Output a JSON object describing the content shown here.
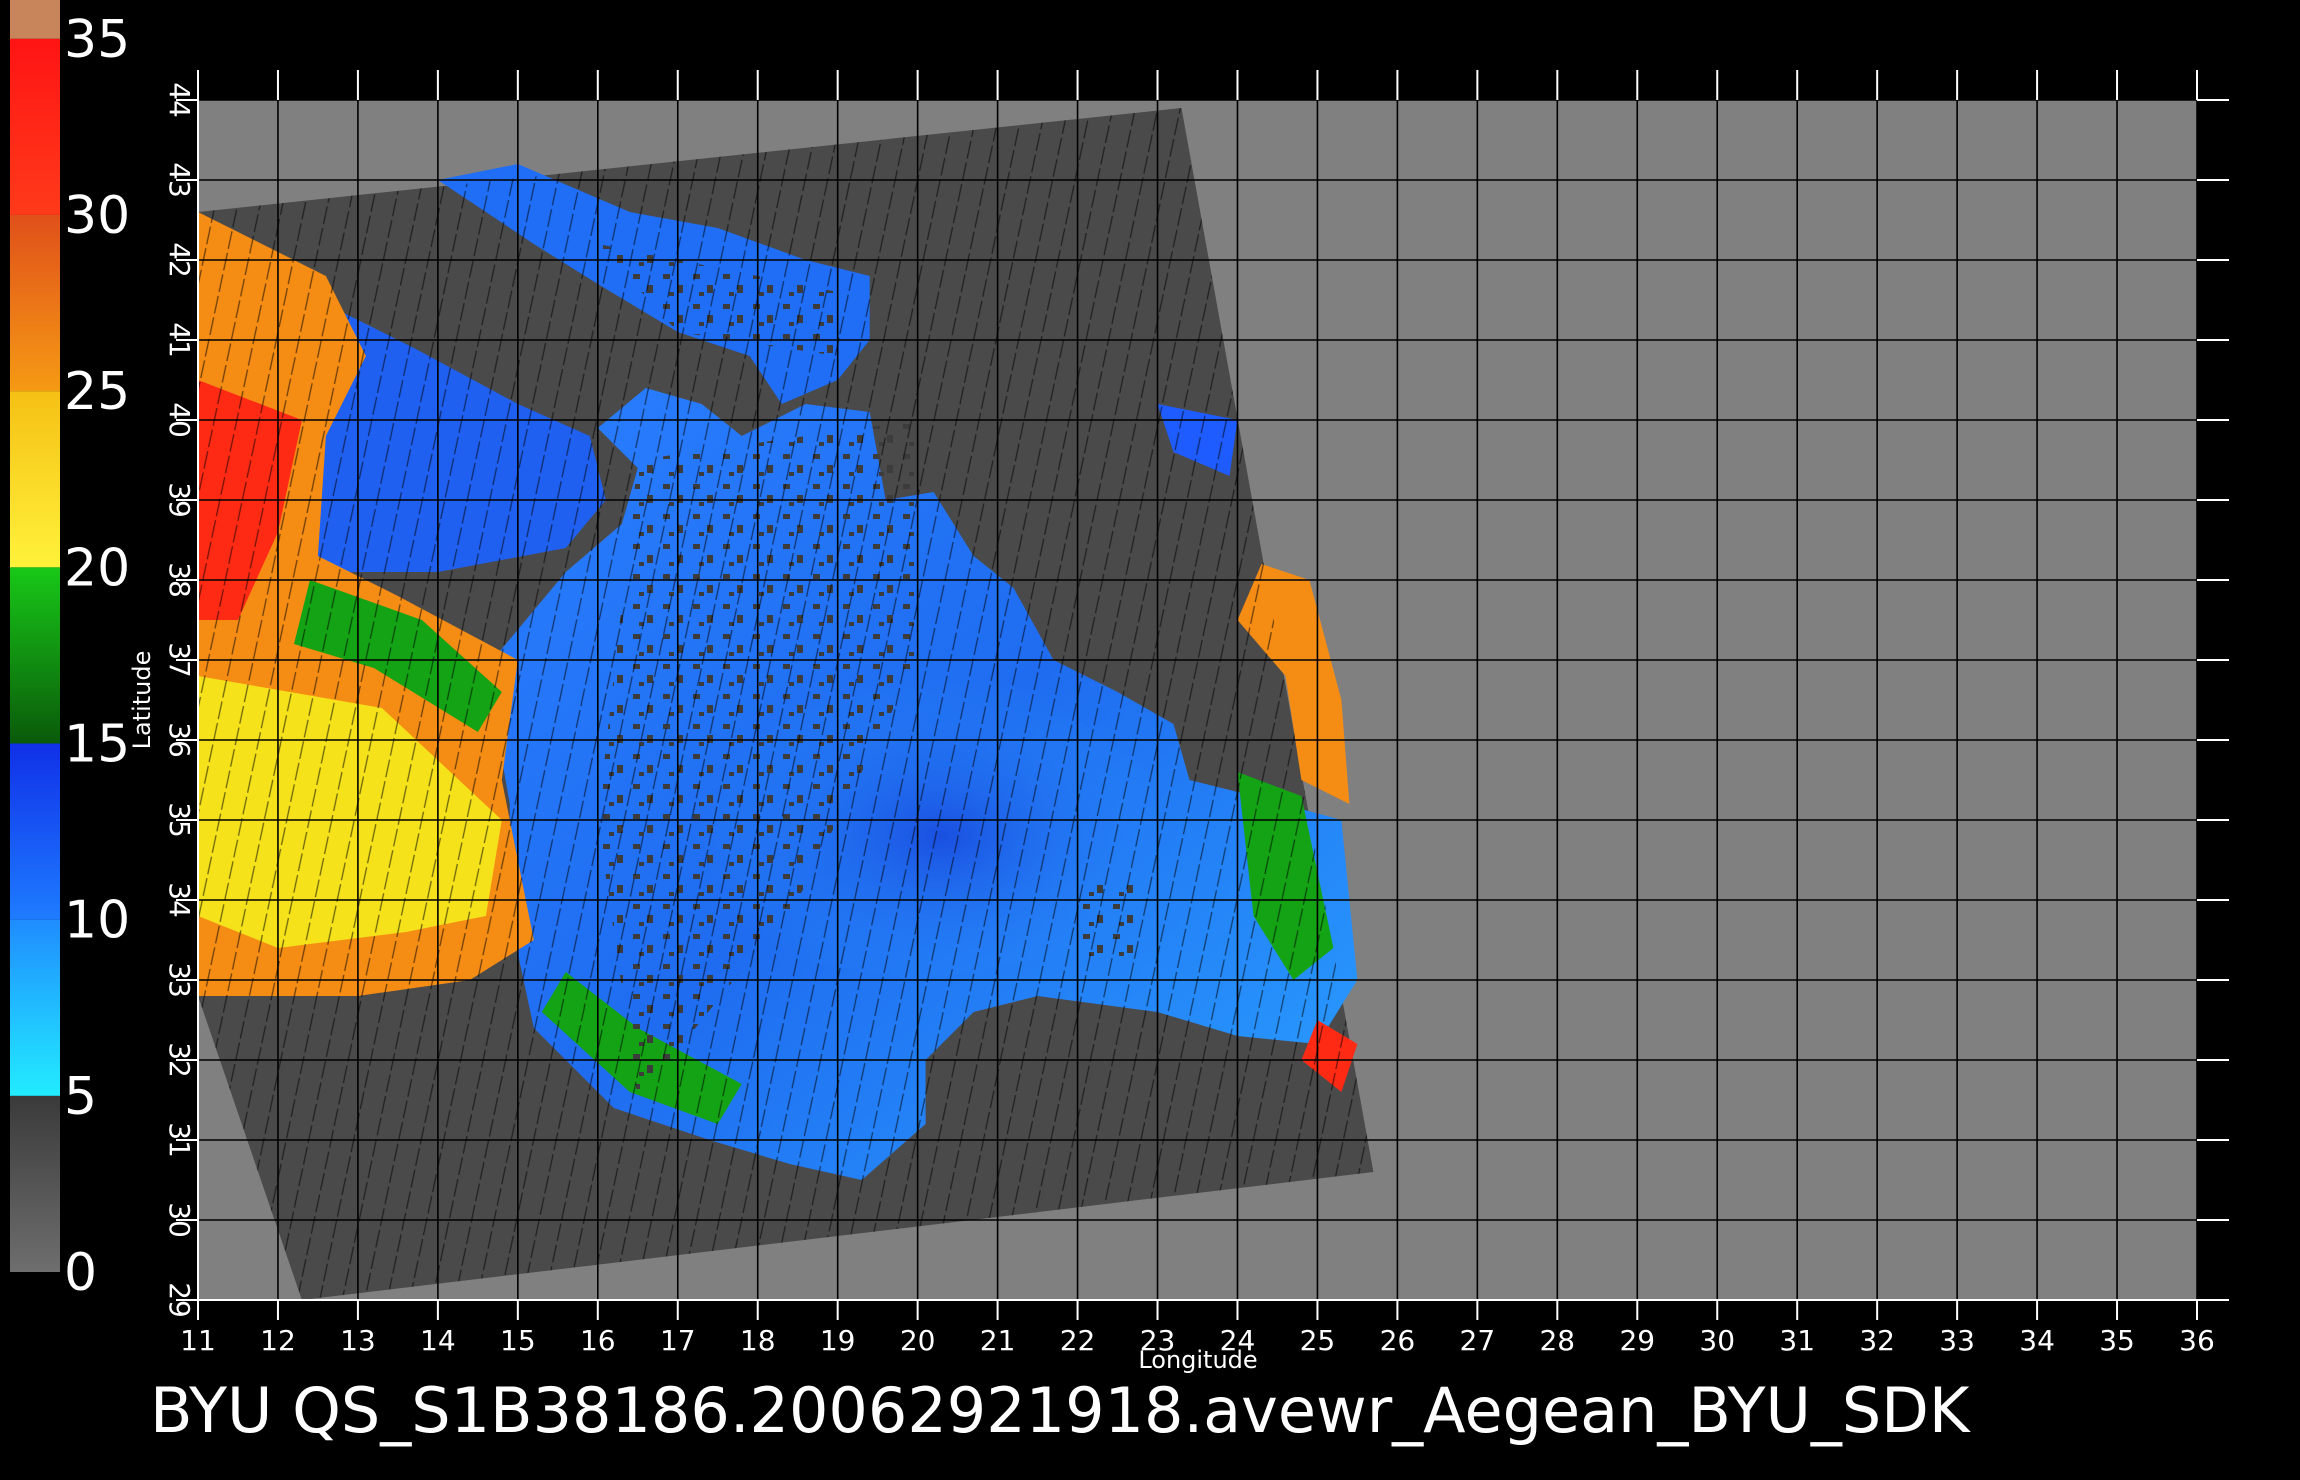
{
  "caption": "BYU  QS_S1B38186.20062921918.avewr_Aegean_BYU_SDK",
  "colorbar": {
    "labels": [
      "35",
      "30",
      "25",
      "20",
      "15",
      "10",
      "5",
      "0"
    ],
    "values": [
      35,
      30,
      25,
      20,
      15,
      10,
      5,
      0
    ],
    "colors": {
      "0-5": "#6e6e6e",
      "5-10": "#29c8ff",
      "10-15": "#1f5cff",
      "15-20": "#14a314",
      "20-25": "#f5e21a",
      "25-30": "#f58c14",
      "30-35": "#ff2a14",
      "35+": "#c8845a"
    }
  },
  "map": {
    "x_axis_title": "Longitude",
    "y_axis_title": "Latitude",
    "lon_range": [
      11,
      36
    ],
    "lat_range": [
      29,
      44
    ],
    "lon_ticks": [
      "11",
      "12",
      "13",
      "14",
      "15",
      "16",
      "17",
      "18",
      "19",
      "20",
      "21",
      "22",
      "23",
      "24",
      "25",
      "26",
      "27",
      "28",
      "29",
      "30",
      "31",
      "32",
      "33",
      "34",
      "35",
      "36"
    ],
    "lat_ticks": [
      "29",
      "30",
      "31",
      "32",
      "33",
      "34",
      "35",
      "36",
      "37",
      "38",
      "39",
      "40",
      "41",
      "42",
      "43",
      "44"
    ],
    "grid": true,
    "background_color": "#808080",
    "swath_color": "#4a4a4a",
    "land_color": "#4a4a4a"
  }
}
